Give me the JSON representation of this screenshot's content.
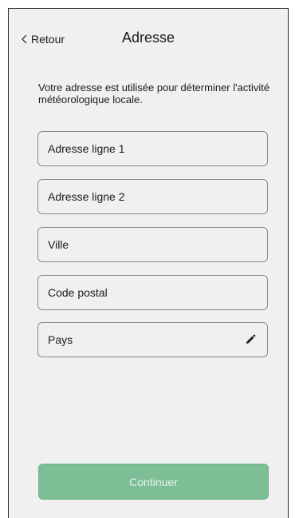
{
  "header": {
    "back_label": "Retour",
    "title": "Adresse"
  },
  "intro_text": "Votre adresse est utilisée pour déterminer l'activité météorologique locale.",
  "fields": [
    {
      "label": "Adresse ligne 1"
    },
    {
      "label": "Adresse ligne 2"
    },
    {
      "label": "Ville"
    },
    {
      "label": "Code postal"
    },
    {
      "label": "Pays",
      "icon": "pencil-icon"
    }
  ],
  "continue_label": "Continuer",
  "colors": {
    "background": "#f0f0f0",
    "border": "#8a8a8a",
    "button": "#7dbe96",
    "button_text": "#e9f3ec",
    "text": "#1a1a1a"
  }
}
